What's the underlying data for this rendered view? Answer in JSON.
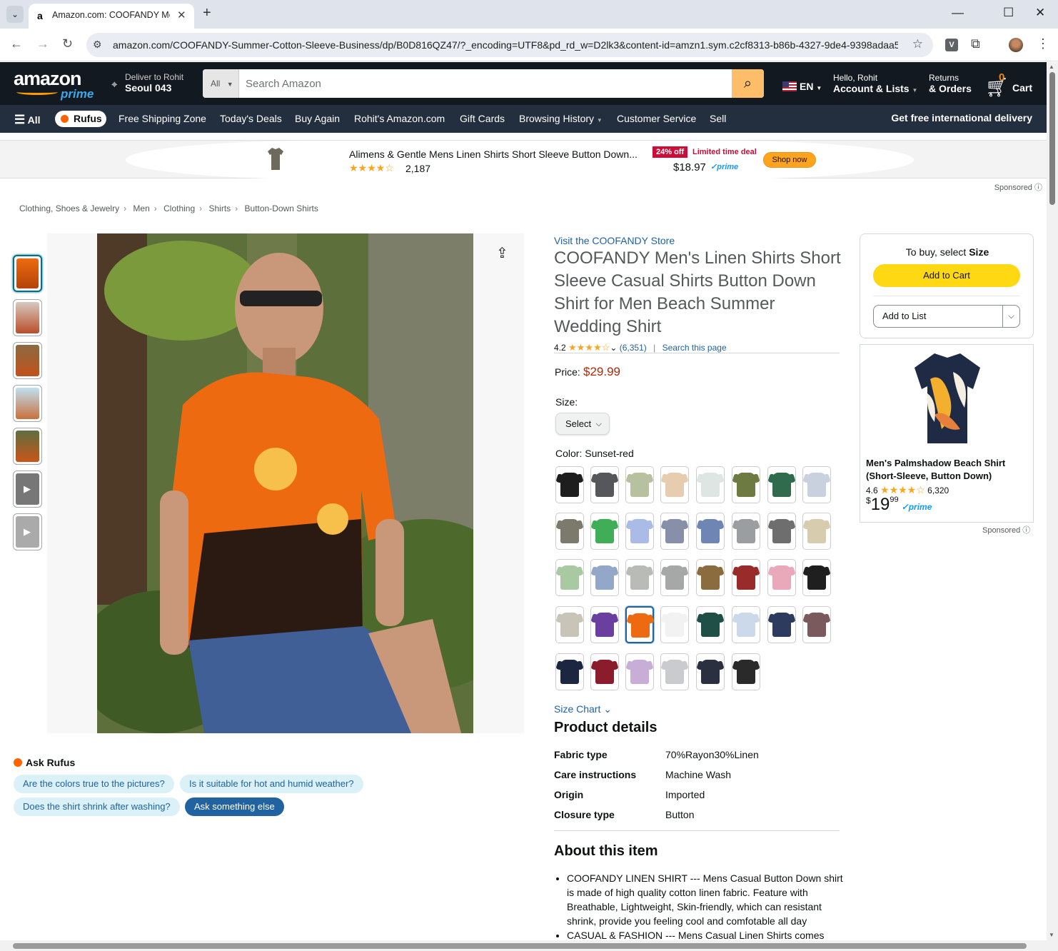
{
  "browser": {
    "tab_title": "Amazon.com: COOFANDY Men",
    "url": "amazon.com/COOFANDY-Summer-Cotton-Sleeve-Business/dp/B0D816QZ47/?_encoding=UTF8&pd_rd_w=D2lk3&content-id=amzn1.sym.c2cf8313-b86b-4327-9de4-9398adaa5..."
  },
  "header": {
    "logo_text": "amazon",
    "logo_sub": "prime",
    "deliver_line1": "Deliver to Rohit",
    "deliver_line2": "Seoul 043",
    "search_category": "All",
    "search_placeholder": "Search Amazon",
    "language": "EN",
    "account_line1": "Hello, Rohit",
    "account_line2": "Account & Lists",
    "returns_line1": "Returns",
    "returns_line2": "& Orders",
    "cart_count": "0",
    "cart_label": "Cart"
  },
  "subnav": {
    "all": "All",
    "rufus": "Rufus",
    "items": [
      "Free Shipping Zone",
      "Today's Deals",
      "Buy Again",
      "Rohit's Amazon.com",
      "Gift Cards",
      "Browsing History",
      "Customer Service",
      "Sell"
    ],
    "right": "Get free international delivery"
  },
  "sponsored_strip": {
    "title": "Alimens & Gentle Mens Linen Shirts Short Sleeve Button Down...",
    "rating_count": "2,187",
    "badge": "24% off",
    "deal": "Limited time deal",
    "price": "$18.97",
    "prime": "prime",
    "button": "Shop now",
    "sponsored": "Sponsored"
  },
  "breadcrumb": [
    "Clothing, Shoes & Jewelry",
    "Men",
    "Clothing",
    "Shirts",
    "Button-Down Shirts"
  ],
  "rufus": {
    "heading": "Ask Rufus",
    "questions": [
      "Are the colors true to the pictures?",
      "Is it suitable for hot and humid weather?",
      "Does the shirt shrink after washing?"
    ],
    "ask": "Ask something else"
  },
  "product": {
    "store": "Visit the COOFANDY Store",
    "title": "COOFANDY Men's Linen Shirts Short Sleeve Casual Shirts Button Down Shirt for Men Beach Summer Wedding Shirt",
    "rating": "4.2",
    "stars": 4.2,
    "review_count": "(6,351)",
    "search_page": "Search this page",
    "price_label": "Price:",
    "price": "$29.99",
    "size_label": "Size:",
    "size_select": "Select",
    "color_label": "Color:",
    "color_value": "Sunset-red",
    "size_chart": "Size Chart",
    "swatches": [
      {
        "color": "#1e1e1e"
      },
      {
        "color": "#55575a"
      },
      {
        "color": "#b7c1a0"
      },
      {
        "color": "#e7cdb0"
      },
      {
        "color": "#dde6e2"
      },
      {
        "color": "#6d7a42"
      },
      {
        "color": "#2f6b4c"
      },
      {
        "color": "#c9d0de"
      },
      {
        "color": "#7b7a6c"
      },
      {
        "color": "#3fae57"
      },
      {
        "color": "#a9bbe6"
      },
      {
        "color": "#8790a8"
      },
      {
        "color": "#6f86b5"
      },
      {
        "color": "#9b9ea0"
      },
      {
        "color": "#6e6e6e"
      },
      {
        "color": "#d8ccae"
      },
      {
        "color": "#a9c9a3"
      },
      {
        "color": "#93a7c9"
      },
      {
        "color": "#b9bcb6"
      },
      {
        "color": "#a6a8a8"
      },
      {
        "color": "#8b6c3e"
      },
      {
        "color": "#9a2b2b"
      },
      {
        "color": "#e9a9bb"
      },
      {
        "color": "#1f1f1f"
      },
      {
        "color": "#c9c4b8"
      },
      {
        "color": "#6a3fa0"
      },
      {
        "color": "#ee6a10"
      },
      {
        "color": "#f2f2f2"
      },
      {
        "color": "#1f4f46"
      },
      {
        "color": "#cbd9ea"
      },
      {
        "color": "#2d3b5e"
      },
      {
        "color": "#7a5a5c"
      },
      {
        "color": "#1d2640"
      },
      {
        "color": "#8a1c2b"
      },
      {
        "color": "#c8aed6"
      },
      {
        "color": "#c9cbcf"
      },
      {
        "color": "#2a3040"
      },
      {
        "color": "#2a2a2a"
      }
    ],
    "selected_swatch": 26
  },
  "details": {
    "heading": "Product details",
    "rows": [
      {
        "k": "Fabric type",
        "v": "70%Rayon30%Linen"
      },
      {
        "k": "Care instructions",
        "v": "Machine Wash"
      },
      {
        "k": "Origin",
        "v": "Imported"
      },
      {
        "k": "Closure type",
        "v": "Button"
      }
    ]
  },
  "about": {
    "heading": "About this item",
    "bullets": [
      "COOFANDY LINEN SHIRT --- Mens Casual Button Down shirt is made of high quality cotton linen fabric. Feature with Breathable, Lightweight, Skin-friendly, which can resistant shrink, provide you feeling cool and comfotable all day",
      "CASUAL & FASHION --- Mens Casual Linen Shirts comes"
    ]
  },
  "buybox": {
    "to_buy": "To buy, select",
    "to_buy_bold": "Size",
    "add_to_cart": "Add to Cart",
    "add_to_list": "Add to List"
  },
  "side_ad": {
    "name": "Men's Palmshadow Beach Shirt (Short-Sleeve, Button Down)",
    "rating": "4.6",
    "count": "6,320",
    "price_dollar": "$",
    "price_whole": "19",
    "price_cents": "99",
    "prime": "prime",
    "sponsored": "Sponsored"
  }
}
